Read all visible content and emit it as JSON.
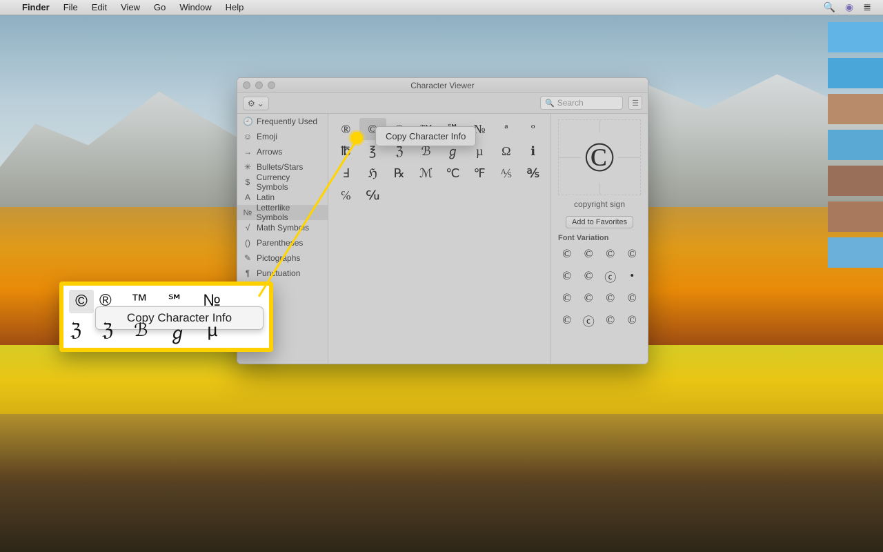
{
  "menubar": {
    "app": "Finder",
    "items": [
      "File",
      "Edit",
      "View",
      "Go",
      "Window",
      "Help"
    ],
    "apple_glyph": "",
    "search_glyph": "🔍",
    "siri_glyph": "◉",
    "list_glyph": "≣"
  },
  "window": {
    "title": "Character Viewer",
    "gear_glyph": "⚙",
    "chevron_glyph": "⌄",
    "search_placeholder": "Search",
    "search_glyph": "🔍",
    "collapse_glyph": "☰"
  },
  "sidebar": {
    "items": [
      {
        "icon": "🕘",
        "label": "Frequently Used"
      },
      {
        "icon": "☺",
        "label": "Emoji"
      },
      {
        "icon": "→",
        "label": "Arrows"
      },
      {
        "icon": "✳",
        "label": "Bullets/Stars"
      },
      {
        "icon": "$",
        "label": "Currency Symbols"
      },
      {
        "icon": "A",
        "label": "Latin"
      },
      {
        "icon": "№",
        "label": "Letterlike Symbols"
      },
      {
        "icon": "√",
        "label": "Math Symbols"
      },
      {
        "icon": "()",
        "label": "Parentheses"
      },
      {
        "icon": "✎",
        "label": "Pictographs"
      },
      {
        "icon": "¶",
        "label": "Punctuation"
      }
    ],
    "selected_index": 6
  },
  "grid": {
    "selected_index": 1,
    "chars": [
      "®",
      "©",
      "℗",
      "™",
      "℠",
      "№",
      "ª",
      "º",
      "℔",
      "℥",
      "ℨ",
      "ℬ",
      "ℊ",
      "µ",
      "Ω",
      "ℹ",
      "Ⅎ",
      "ℌ",
      "℞",
      "ℳ",
      "℃",
      "℉",
      "⅍",
      "℁",
      "℅",
      "℆"
    ]
  },
  "context_menu": {
    "label": "Copy Character Info"
  },
  "detail": {
    "preview_char": "©",
    "name": "copyright sign",
    "favorites_label": "Add to Favorites",
    "section": "Font Variation",
    "variations": [
      "©",
      "©",
      "©",
      "©",
      "©",
      "©",
      "ⓒ",
      "•",
      "©",
      "©",
      "©",
      "©",
      "©",
      "ⓒ",
      "©",
      "©"
    ]
  },
  "callout": {
    "selected_char": "©",
    "top_row": [
      "®",
      "™",
      "℠",
      "№"
    ],
    "bottom_row": [
      "ℨ",
      "ℨ",
      "ℬ",
      "ℊ",
      "µ"
    ],
    "menu_label": "Copy Character Info"
  }
}
